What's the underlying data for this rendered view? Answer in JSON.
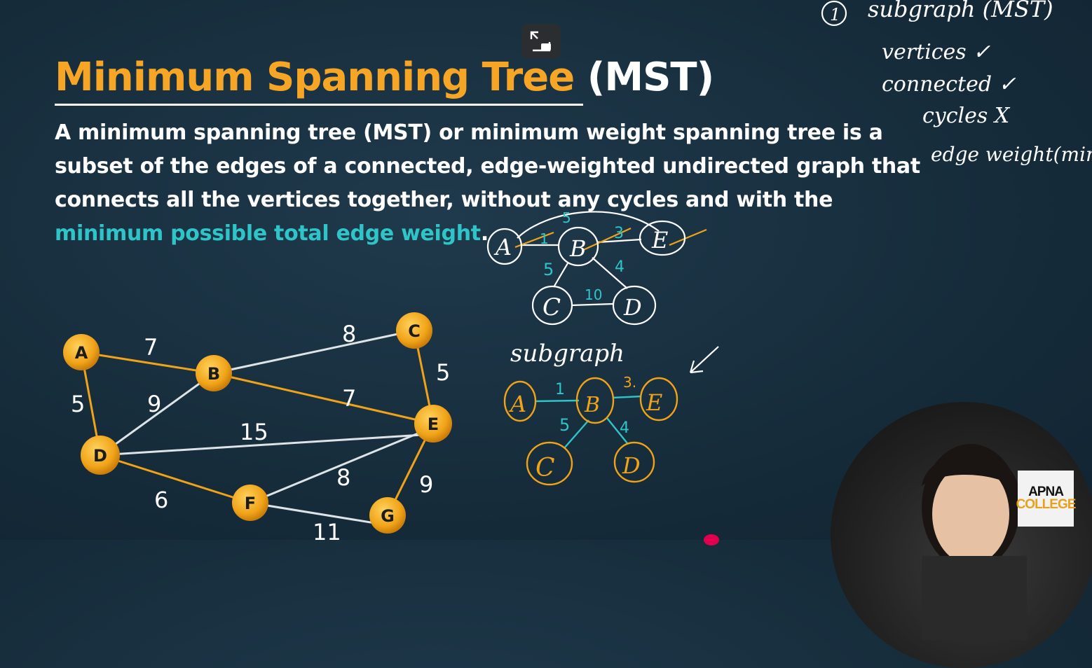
{
  "title": {
    "main": "Minimum Spanning Tree",
    "abbr": "(MST)"
  },
  "definition": {
    "text": "A minimum spanning tree (MST) or minimum weight spanning tree is a subset of the edges of a connected, edge-weighted undirected graph that connects all the vertices together, without any cycles and with the ",
    "highlight": "minimum possible total edge weight",
    "end": "."
  },
  "graph": {
    "nodes": [
      "A",
      "B",
      "C",
      "D",
      "E",
      "F",
      "G"
    ],
    "edges": [
      {
        "from": "A",
        "to": "B",
        "weight": "7",
        "mst": true
      },
      {
        "from": "A",
        "to": "D",
        "weight": "5",
        "mst": true
      },
      {
        "from": "B",
        "to": "D",
        "weight": "9",
        "mst": false
      },
      {
        "from": "B",
        "to": "C",
        "weight": "8",
        "mst": false
      },
      {
        "from": "B",
        "to": "E",
        "weight": "7",
        "mst": true
      },
      {
        "from": "C",
        "to": "E",
        "weight": "5",
        "mst": true
      },
      {
        "from": "D",
        "to": "E",
        "weight": "15",
        "mst": false
      },
      {
        "from": "D",
        "to": "F",
        "weight": "6",
        "mst": true
      },
      {
        "from": "F",
        "to": "E",
        "weight": "8",
        "mst": false
      },
      {
        "from": "E",
        "to": "G",
        "weight": "9",
        "mst": true
      },
      {
        "from": "F",
        "to": "G",
        "weight": "11",
        "mst": false
      }
    ]
  },
  "notes": {
    "item_number": "1",
    "heading": "subgraph (MST)",
    "lines": [
      "vertices ✓",
      "connected ✓",
      "cycles X",
      "edge weight(min)"
    ],
    "subgraph_label": "subgraph"
  },
  "sketch_top": {
    "nodes": [
      "A",
      "B",
      "E",
      "C",
      "D"
    ],
    "weights": [
      "5",
      "1",
      "3",
      "5",
      "4",
      "10"
    ]
  },
  "sketch_bottom": {
    "nodes": [
      "A",
      "B",
      "E",
      "C",
      "D"
    ],
    "weights": [
      "1",
      "3.",
      "5",
      "4"
    ]
  },
  "logo": {
    "line1": "APNA",
    "line2": "COLLEGE"
  },
  "colors": {
    "accent_orange": "#f6a524",
    "accent_cyan": "#2fc4c8",
    "node_fill": "#f0a318",
    "background": "#162c3b"
  }
}
